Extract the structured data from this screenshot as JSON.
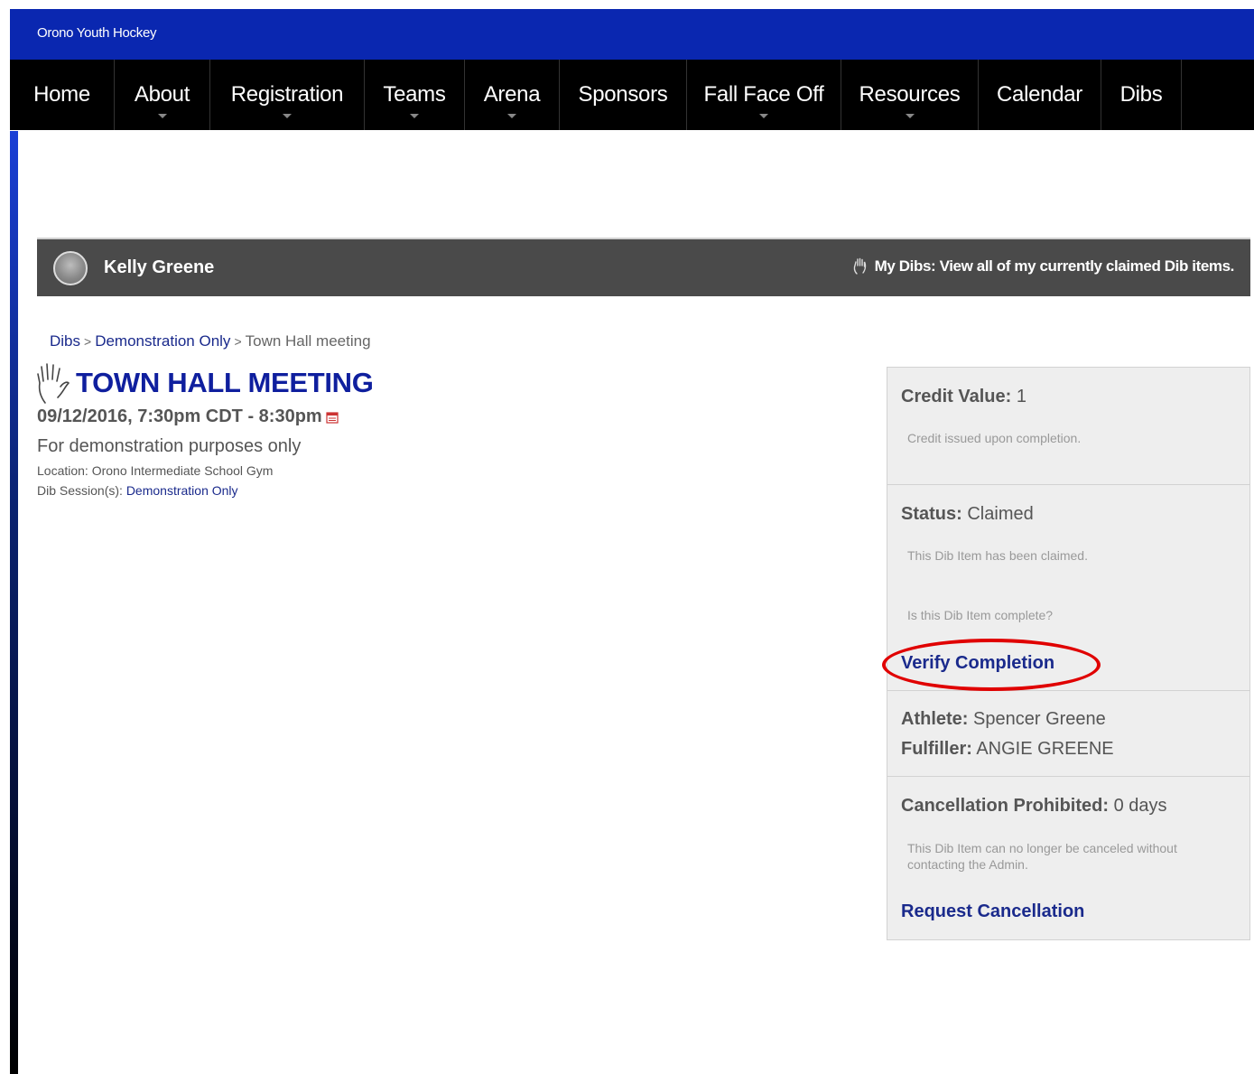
{
  "site": {
    "title": "Orono Youth Hockey"
  },
  "nav": {
    "items": [
      {
        "label": "Home"
      },
      {
        "label": "About"
      },
      {
        "label": "Registration"
      },
      {
        "label": "Teams"
      },
      {
        "label": "Arena"
      },
      {
        "label": "Sponsors"
      },
      {
        "label": "Fall Face Off"
      },
      {
        "label": "Resources"
      },
      {
        "label": "Calendar"
      },
      {
        "label": "Dibs"
      }
    ]
  },
  "userbar": {
    "name": "Kelly Greene",
    "my_dibs": "My Dibs: View all of my currently claimed Dib items."
  },
  "breadcrumb": {
    "root": "Dibs",
    "sep": ">",
    "category": "Demonstration Only",
    "current": "Town Hall meeting"
  },
  "event": {
    "title": "TOWN HALL MEETING",
    "datetime": "09/12/2016, 7:30pm CDT - 8:30pm",
    "description": "For demonstration purposes only",
    "location": "Location: Orono Intermediate School Gym",
    "session_label": "Dib Session(s):",
    "session_value": "Demonstration Only"
  },
  "panel": {
    "credit_label": "Credit Value:",
    "credit_value": "1",
    "credit_note": "Credit issued upon completion.",
    "status_label": "Status:",
    "status_value": "Claimed",
    "status_note": "This Dib Item has been claimed.",
    "complete_question": "Is this Dib Item complete?",
    "verify_link": "Verify Completion",
    "athlete_label": "Athlete:",
    "athlete_value": "Spencer Greene",
    "fulfiller_label": "Fulfiller:",
    "fulfiller_value": "ANGIE GREENE",
    "cancel_label": "Cancellation Prohibited:",
    "cancel_value": "0 days",
    "cancel_note": "This Dib Item can no longer be canceled without contacting the Admin.",
    "cancel_link": "Request Cancellation"
  },
  "colors": {
    "topbar": "#0a27b0",
    "navbar": "#000000",
    "link": "#1a2a8c",
    "title": "#0f1f9e",
    "highlight": "#e00000"
  }
}
